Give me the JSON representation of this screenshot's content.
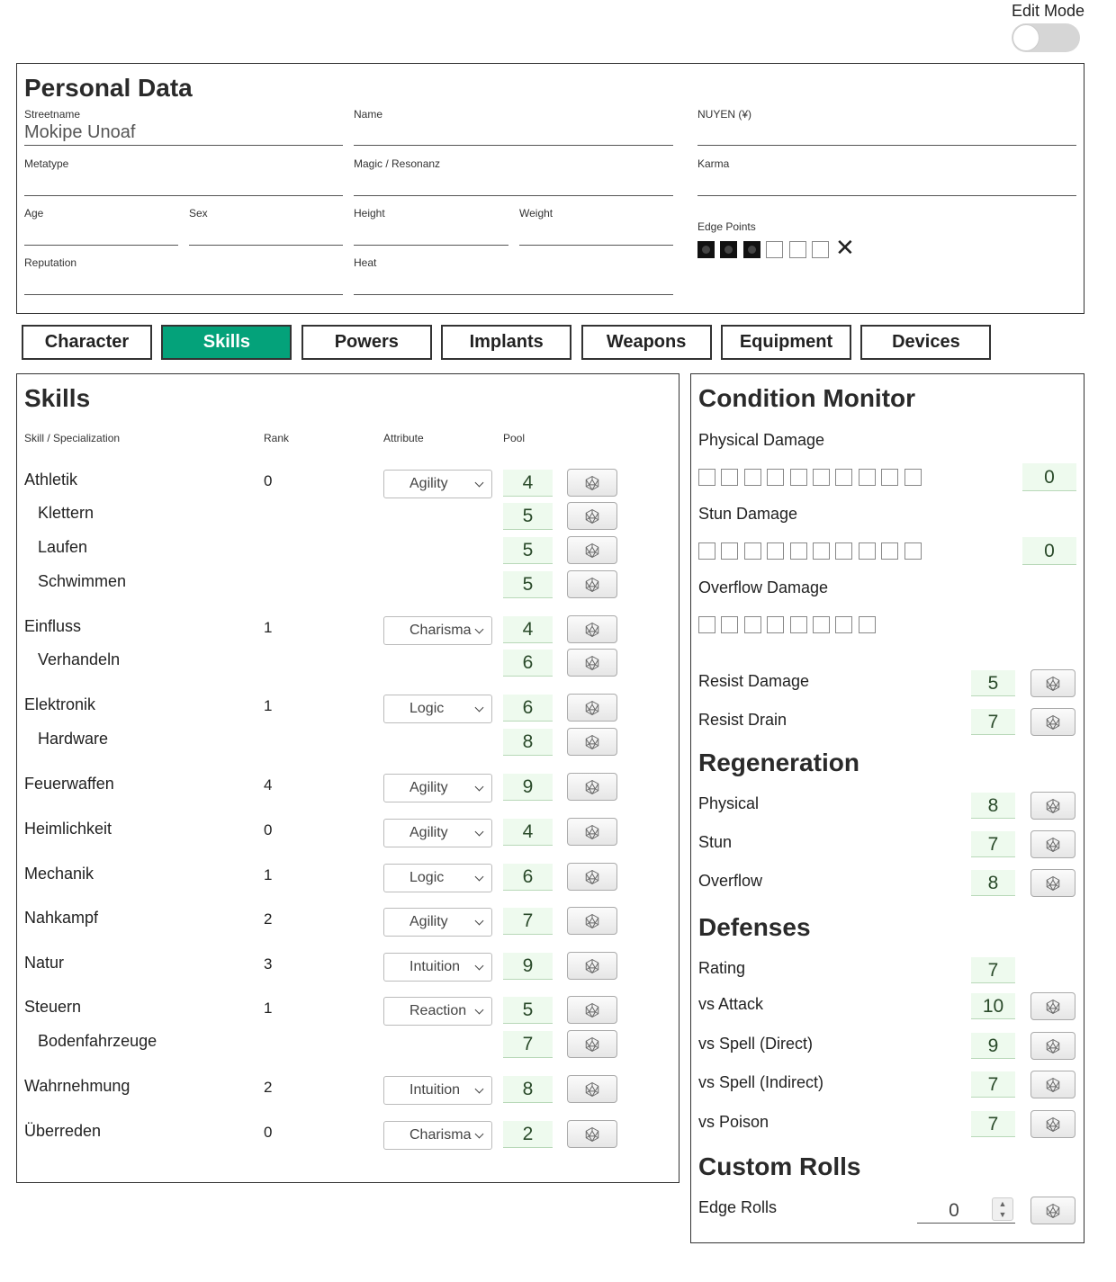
{
  "edit_mode": {
    "label": "Edit Mode",
    "on": false
  },
  "personal": {
    "title": "Personal Data",
    "fields": {
      "streetname": {
        "label": "Streetname",
        "value": "Mokipe Unoaf"
      },
      "name": {
        "label": "Name",
        "value": ""
      },
      "nuyen": {
        "label": "NUYEN (¥)",
        "value": ""
      },
      "metatype": {
        "label": "Metatype",
        "value": ""
      },
      "magic": {
        "label": "Magic / Resonanz",
        "value": ""
      },
      "karma": {
        "label": "Karma",
        "value": ""
      },
      "age": {
        "label": "Age",
        "value": ""
      },
      "sex": {
        "label": "Sex",
        "value": ""
      },
      "height": {
        "label": "Height",
        "value": ""
      },
      "weight": {
        "label": "Weight",
        "value": ""
      },
      "reputation": {
        "label": "Reputation",
        "value": ""
      },
      "heat": {
        "label": "Heat",
        "value": ""
      }
    },
    "edge": {
      "label": "Edge Points",
      "filled": 3,
      "total": 6,
      "clear_glyph": "✕"
    }
  },
  "tabs": [
    "Character",
    "Skills",
    "Powers",
    "Implants",
    "Weapons",
    "Equipment",
    "Devices"
  ],
  "active_tab": "Skills",
  "skills": {
    "title": "Skills",
    "headers": {
      "name": "Skill / Specialization",
      "rank": "Rank",
      "attribute": "Attribute",
      "pool": "Pool"
    },
    "rows": [
      {
        "name": "Athletik",
        "rank": "0",
        "attribute": "Agility",
        "pool": "4",
        "spec": false
      },
      {
        "name": "Klettern",
        "rank": "",
        "attribute": "",
        "pool": "5",
        "spec": true
      },
      {
        "name": "Laufen",
        "rank": "",
        "attribute": "",
        "pool": "5",
        "spec": true
      },
      {
        "name": "Schwimmen",
        "rank": "",
        "attribute": "",
        "pool": "5",
        "spec": true
      },
      {
        "name": "Einfluss",
        "rank": "1",
        "attribute": "Charisma",
        "pool": "4",
        "spec": false
      },
      {
        "name": "Verhandeln",
        "rank": "",
        "attribute": "",
        "pool": "6",
        "spec": true
      },
      {
        "name": "Elektronik",
        "rank": "1",
        "attribute": "Logic",
        "pool": "6",
        "spec": false
      },
      {
        "name": "Hardware",
        "rank": "",
        "attribute": "",
        "pool": "8",
        "spec": true
      },
      {
        "name": "Feuerwaffen",
        "rank": "4",
        "attribute": "Agility",
        "pool": "9",
        "spec": false
      },
      {
        "name": "Heimlichkeit",
        "rank": "0",
        "attribute": "Agility",
        "pool": "4",
        "spec": false
      },
      {
        "name": "Mechanik",
        "rank": "1",
        "attribute": "Logic",
        "pool": "6",
        "spec": false
      },
      {
        "name": "Nahkampf",
        "rank": "2",
        "attribute": "Agility",
        "pool": "7",
        "spec": false
      },
      {
        "name": "Natur",
        "rank": "3",
        "attribute": "Intuition",
        "pool": "9",
        "spec": false
      },
      {
        "name": "Steuern",
        "rank": "1",
        "attribute": "Reaction",
        "pool": "5",
        "spec": false
      },
      {
        "name": "Bodenfahrzeuge",
        "rank": "",
        "attribute": "",
        "pool": "7",
        "spec": true
      },
      {
        "name": "Wahrnehmung",
        "rank": "2",
        "attribute": "Intuition",
        "pool": "8",
        "spec": false
      },
      {
        "name": "Überreden",
        "rank": "0",
        "attribute": "Charisma",
        "pool": "2",
        "spec": false
      }
    ]
  },
  "condition": {
    "title": "Condition Monitor",
    "physical": {
      "label": "Physical Damage",
      "boxes": 10,
      "value": "0"
    },
    "stun": {
      "label": "Stun Damage",
      "boxes": 10,
      "value": "0"
    },
    "overflow": {
      "label": "Overflow Damage",
      "boxes": 8
    },
    "resist": [
      {
        "label": "Resist Damage",
        "value": "5"
      },
      {
        "label": "Resist Drain",
        "value": "7"
      }
    ]
  },
  "regeneration": {
    "title": "Regeneration",
    "rows": [
      {
        "label": "Physical",
        "value": "8"
      },
      {
        "label": "Stun",
        "value": "7"
      },
      {
        "label": "Overflow",
        "value": "8"
      }
    ]
  },
  "defenses": {
    "title": "Defenses",
    "rows": [
      {
        "label": "Rating",
        "value": "7",
        "roll": false
      },
      {
        "label": "vs Attack",
        "value": "10",
        "roll": true
      },
      {
        "label": "vs Spell (Direct)",
        "value": "9",
        "roll": true
      },
      {
        "label": "vs Spell (Indirect)",
        "value": "7",
        "roll": true
      },
      {
        "label": "vs Poison",
        "value": "7",
        "roll": true
      }
    ]
  },
  "custom_rolls": {
    "title": "Custom Rolls",
    "edge_rolls": {
      "label": "Edge Rolls",
      "value": "0"
    }
  },
  "icons": {
    "roll": "d20-dice-icon",
    "dropdown": "chevron-down-icon",
    "spinner": "spinner-arrows-icon"
  }
}
